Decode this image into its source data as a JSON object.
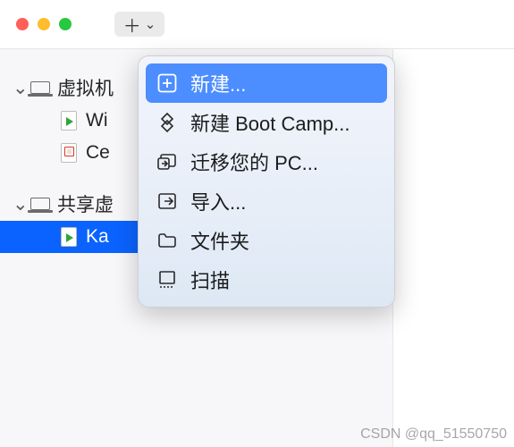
{
  "toolbar": {
    "add_glyph": "＋",
    "chev_glyph": "⌄"
  },
  "sidebar": {
    "sections": [
      {
        "label": "虚拟机",
        "items": [
          {
            "label": "Wi",
            "icon": "play"
          },
          {
            "label": "Ce",
            "icon": "stop"
          }
        ]
      },
      {
        "label": "共享虚",
        "items": [
          {
            "label": "Ka",
            "icon": "play",
            "selected": true
          }
        ]
      }
    ]
  },
  "menu": {
    "items": [
      {
        "label": "新建...",
        "icon": "plus-square",
        "highlight": true
      },
      {
        "label": "新建 Boot Camp...",
        "icon": "diamond"
      },
      {
        "label": "迁移您的 PC...",
        "icon": "migrate"
      },
      {
        "label": "导入...",
        "icon": "import"
      },
      {
        "label": "文件夹",
        "icon": "folder"
      },
      {
        "label": "扫描",
        "icon": "scan"
      }
    ]
  },
  "watermark": "CSDN @qq_51550750"
}
